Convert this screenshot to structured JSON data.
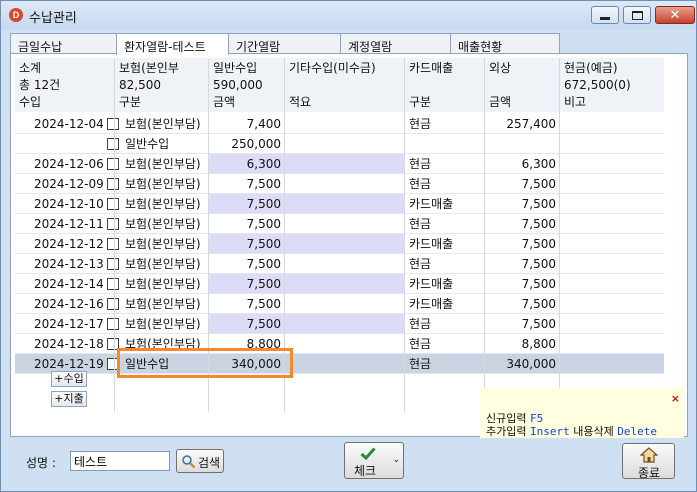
{
  "window": {
    "title": "수납관리",
    "app_icon_letter": "D"
  },
  "tabs": [
    {
      "label": "금일수납"
    },
    {
      "label": "환자열람-테스트"
    },
    {
      "label": "기간열람"
    },
    {
      "label": "계정열람"
    },
    {
      "label": "매출현황"
    }
  ],
  "grid": {
    "header1": [
      "소계",
      "보험(본인부",
      "일반수입",
      "기타수입(미수금)",
      "카드매출",
      "외상",
      "현금(예금)"
    ],
    "totals": [
      "총 12건",
      "82,500",
      "590,000",
      "",
      "",
      "",
      "672,500(0)"
    ],
    "header2": [
      "수입",
      "구분",
      "금액",
      "적요",
      "구분",
      "금액",
      "비고"
    ],
    "rows": [
      {
        "date": "2024-12-04",
        "type": "보험(본인부담)",
        "amount": "7,400",
        "memo": "",
        "pay": "현금",
        "pay_amount": "257,400",
        "note": ""
      },
      {
        "date": "",
        "type": "일반수입",
        "amount": "250,000",
        "memo": "",
        "pay": "",
        "pay_amount": "",
        "note": ""
      },
      {
        "date": "2024-12-06",
        "type": "보험(본인부담)",
        "amount": "6,300",
        "memo": "",
        "pay": "현금",
        "pay_amount": "6,300",
        "note": ""
      },
      {
        "date": "2024-12-09",
        "type": "보험(본인부담)",
        "amount": "7,500",
        "memo": "",
        "pay": "현금",
        "pay_amount": "7,500",
        "note": ""
      },
      {
        "date": "2024-12-10",
        "type": "보험(본인부담)",
        "amount": "7,500",
        "memo": "",
        "pay": "카드매출",
        "pay_amount": "7,500",
        "note": ""
      },
      {
        "date": "2024-12-11",
        "type": "보험(본인부담)",
        "amount": "7,500",
        "memo": "",
        "pay": "현금",
        "pay_amount": "7,500",
        "note": ""
      },
      {
        "date": "2024-12-12",
        "type": "보험(본인부담)",
        "amount": "7,500",
        "memo": "",
        "pay": "카드매출",
        "pay_amount": "7,500",
        "note": ""
      },
      {
        "date": "2024-12-13",
        "type": "보험(본인부담)",
        "amount": "7,500",
        "memo": "",
        "pay": "현금",
        "pay_amount": "7,500",
        "note": ""
      },
      {
        "date": "2024-12-14",
        "type": "보험(본인부담)",
        "amount": "7,500",
        "memo": "",
        "pay": "카드매출",
        "pay_amount": "7,500",
        "note": ""
      },
      {
        "date": "2024-12-16",
        "type": "보험(본인부담)",
        "amount": "7,500",
        "memo": "",
        "pay": "카드매출",
        "pay_amount": "7,500",
        "note": ""
      },
      {
        "date": "2024-12-17",
        "type": "보험(본인부담)",
        "amount": "7,500",
        "memo": "",
        "pay": "현금",
        "pay_amount": "7,500",
        "note": ""
      },
      {
        "date": "2024-12-18",
        "type": "보험(본인부담)",
        "amount": "8,800",
        "memo": "",
        "pay": "현금",
        "pay_amount": "8,800",
        "note": ""
      },
      {
        "date": "2024-12-19",
        "type": "일반수입",
        "amount": "340,000",
        "memo": "",
        "pay": "현금",
        "pay_amount": "340,000",
        "note": ""
      }
    ],
    "add_income_label": "+수입",
    "add_expense_label": "+지출"
  },
  "shortcut_tip": {
    "close": "×",
    "new_label": "신규입력",
    "new_key": "F5",
    "add_label": "추가입력",
    "add_key": "Insert",
    "delete_label": "내용삭제",
    "delete_key": "Delete"
  },
  "bottom": {
    "name_label": "성명 :",
    "name_value": "테스트",
    "search_label": "검색",
    "check_label": "체크",
    "close_label": "종료"
  },
  "colors": {
    "highlight": "#f08a2b",
    "row_tint": "#dcdcf7",
    "selected_row": "#c9d3e2"
  }
}
